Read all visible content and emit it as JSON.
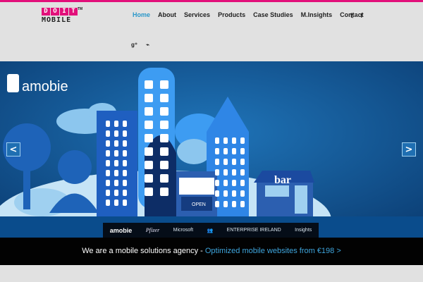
{
  "logo": {
    "letters": [
      "D",
      "O",
      "I",
      "T"
    ],
    "word": "MOBILE",
    "tm": "TM"
  },
  "nav": {
    "items": [
      {
        "label": "Home",
        "active": true
      },
      {
        "label": "About"
      },
      {
        "label": "Services"
      },
      {
        "label": "Products"
      },
      {
        "label": "Case Studies"
      },
      {
        "label": "M.Insights"
      },
      {
        "label": "Contact"
      }
    ]
  },
  "social": {
    "twitter": "𝕥",
    "facebook": "f",
    "googleplus": "g⁺",
    "rss": "⌁"
  },
  "slider": {
    "brand": "amobie",
    "shop_sign": "OPEN",
    "bar_sign": "bar",
    "prev": "<",
    "next": ">",
    "strip": [
      "amobie",
      "Pfizer",
      "Microsoft",
      "ENTERPRISE IRELAND",
      "Insights"
    ]
  },
  "strapline": {
    "text": "We are a mobile solutions agency - ",
    "link": "Optimized mobile websites from €198 >"
  },
  "colors": {
    "accent": "#e2107a",
    "link": "#2a97c9"
  }
}
